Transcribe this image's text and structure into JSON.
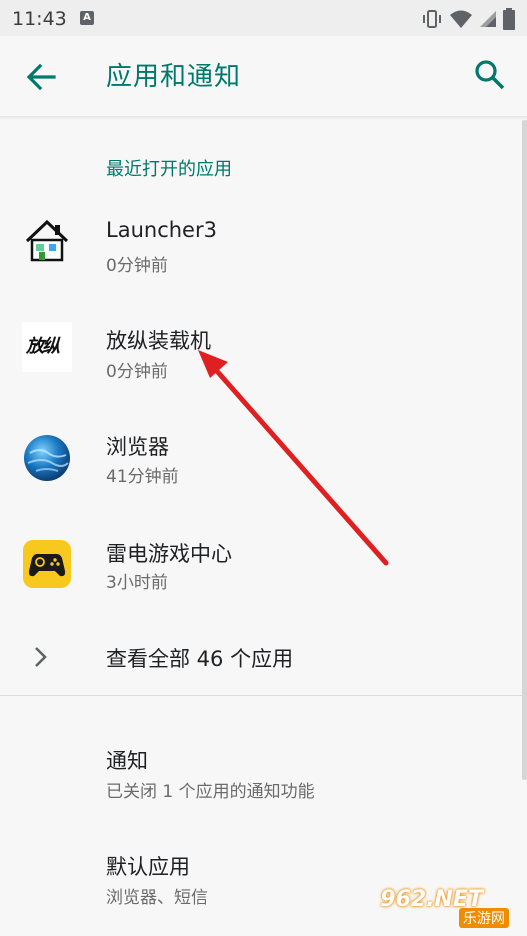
{
  "status_bar": {
    "time": "11:43",
    "notification_letter": "A"
  },
  "app_bar": {
    "title": "应用和通知"
  },
  "recent": {
    "header": "最近打开的应用",
    "apps": [
      {
        "name": "Launcher3",
        "time": "0分钟前",
        "icon": "house-icon"
      },
      {
        "name": "放纵装载机",
        "time": "0分钟前",
        "icon": "calligraphy-icon",
        "icon_text": "放纵"
      },
      {
        "name": "浏览器",
        "time": "41分钟前",
        "icon": "globe-icon"
      },
      {
        "name": "雷电游戏中心",
        "time": "3小时前",
        "icon": "gamepad-icon"
      }
    ],
    "see_all": "查看全部 46 个应用"
  },
  "settings": [
    {
      "title": "通知",
      "subtitle": "已关闭 1 个应用的通知功能"
    },
    {
      "title": "默认应用",
      "subtitle": "浏览器、短信"
    }
  ],
  "watermark": {
    "brand": "962.NET",
    "sub": "乐游网"
  },
  "colors": {
    "accent": "#00796b",
    "arrow": "#e02020"
  }
}
